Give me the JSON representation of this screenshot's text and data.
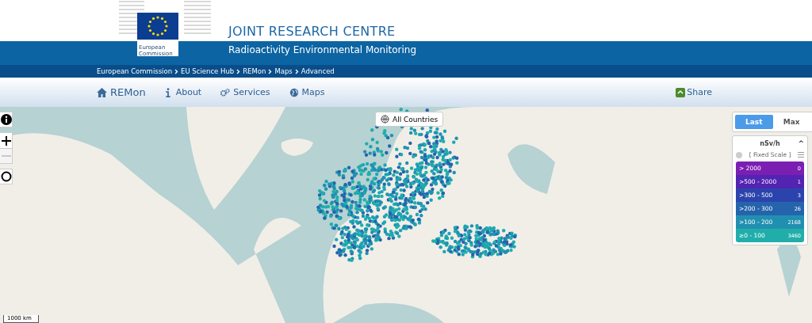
{
  "header": {
    "logo_caption": [
      "European",
      "Commission"
    ],
    "title": "JOINT RESEARCH CENTRE",
    "subtitle": "Radioactivity Environmental Monitoring"
  },
  "breadcrumb": [
    "European Commission",
    "EU Science Hub",
    "REMon",
    "Maps",
    "Advanced"
  ],
  "nav": {
    "brand": "REMon",
    "items": [
      {
        "label": "About"
      },
      {
        "label": "Services"
      },
      {
        "label": "Maps"
      }
    ],
    "share": "Share"
  },
  "map": {
    "country_filter": "All Countries",
    "scale": "1000 km",
    "controls": [
      {
        "kind": "info",
        "disabled": false
      },
      {
        "kind": "zoom-in",
        "disabled": false
      },
      {
        "kind": "zoom-out",
        "disabled": true
      },
      {
        "kind": "reset",
        "disabled": false
      }
    ],
    "toggle": [
      {
        "label": "Last",
        "selected": true
      },
      {
        "label": "Max",
        "selected": false
      }
    ],
    "legend": {
      "unit": "nSv/h",
      "collapse": "^",
      "scale_label": "[ Fixed Scale ]",
      "ranges": [
        {
          "label": "> 2000",
          "count": "0",
          "color": "#7b1fb3"
        },
        {
          "label": ">500 - 2000",
          "count": "1",
          "color": "#5323b2"
        },
        {
          "label": ">300 - 500",
          "count": "3",
          "color": "#2b44ad"
        },
        {
          "label": ">200 - 300",
          "count": "26",
          "color": "#2564ac"
        },
        {
          "label": ">100 - 200",
          "count": "2168",
          "color": "#2190b0"
        },
        {
          "label": "≥0 - 100",
          "count": "3460",
          "color": "#21aeab"
        }
      ]
    }
  }
}
